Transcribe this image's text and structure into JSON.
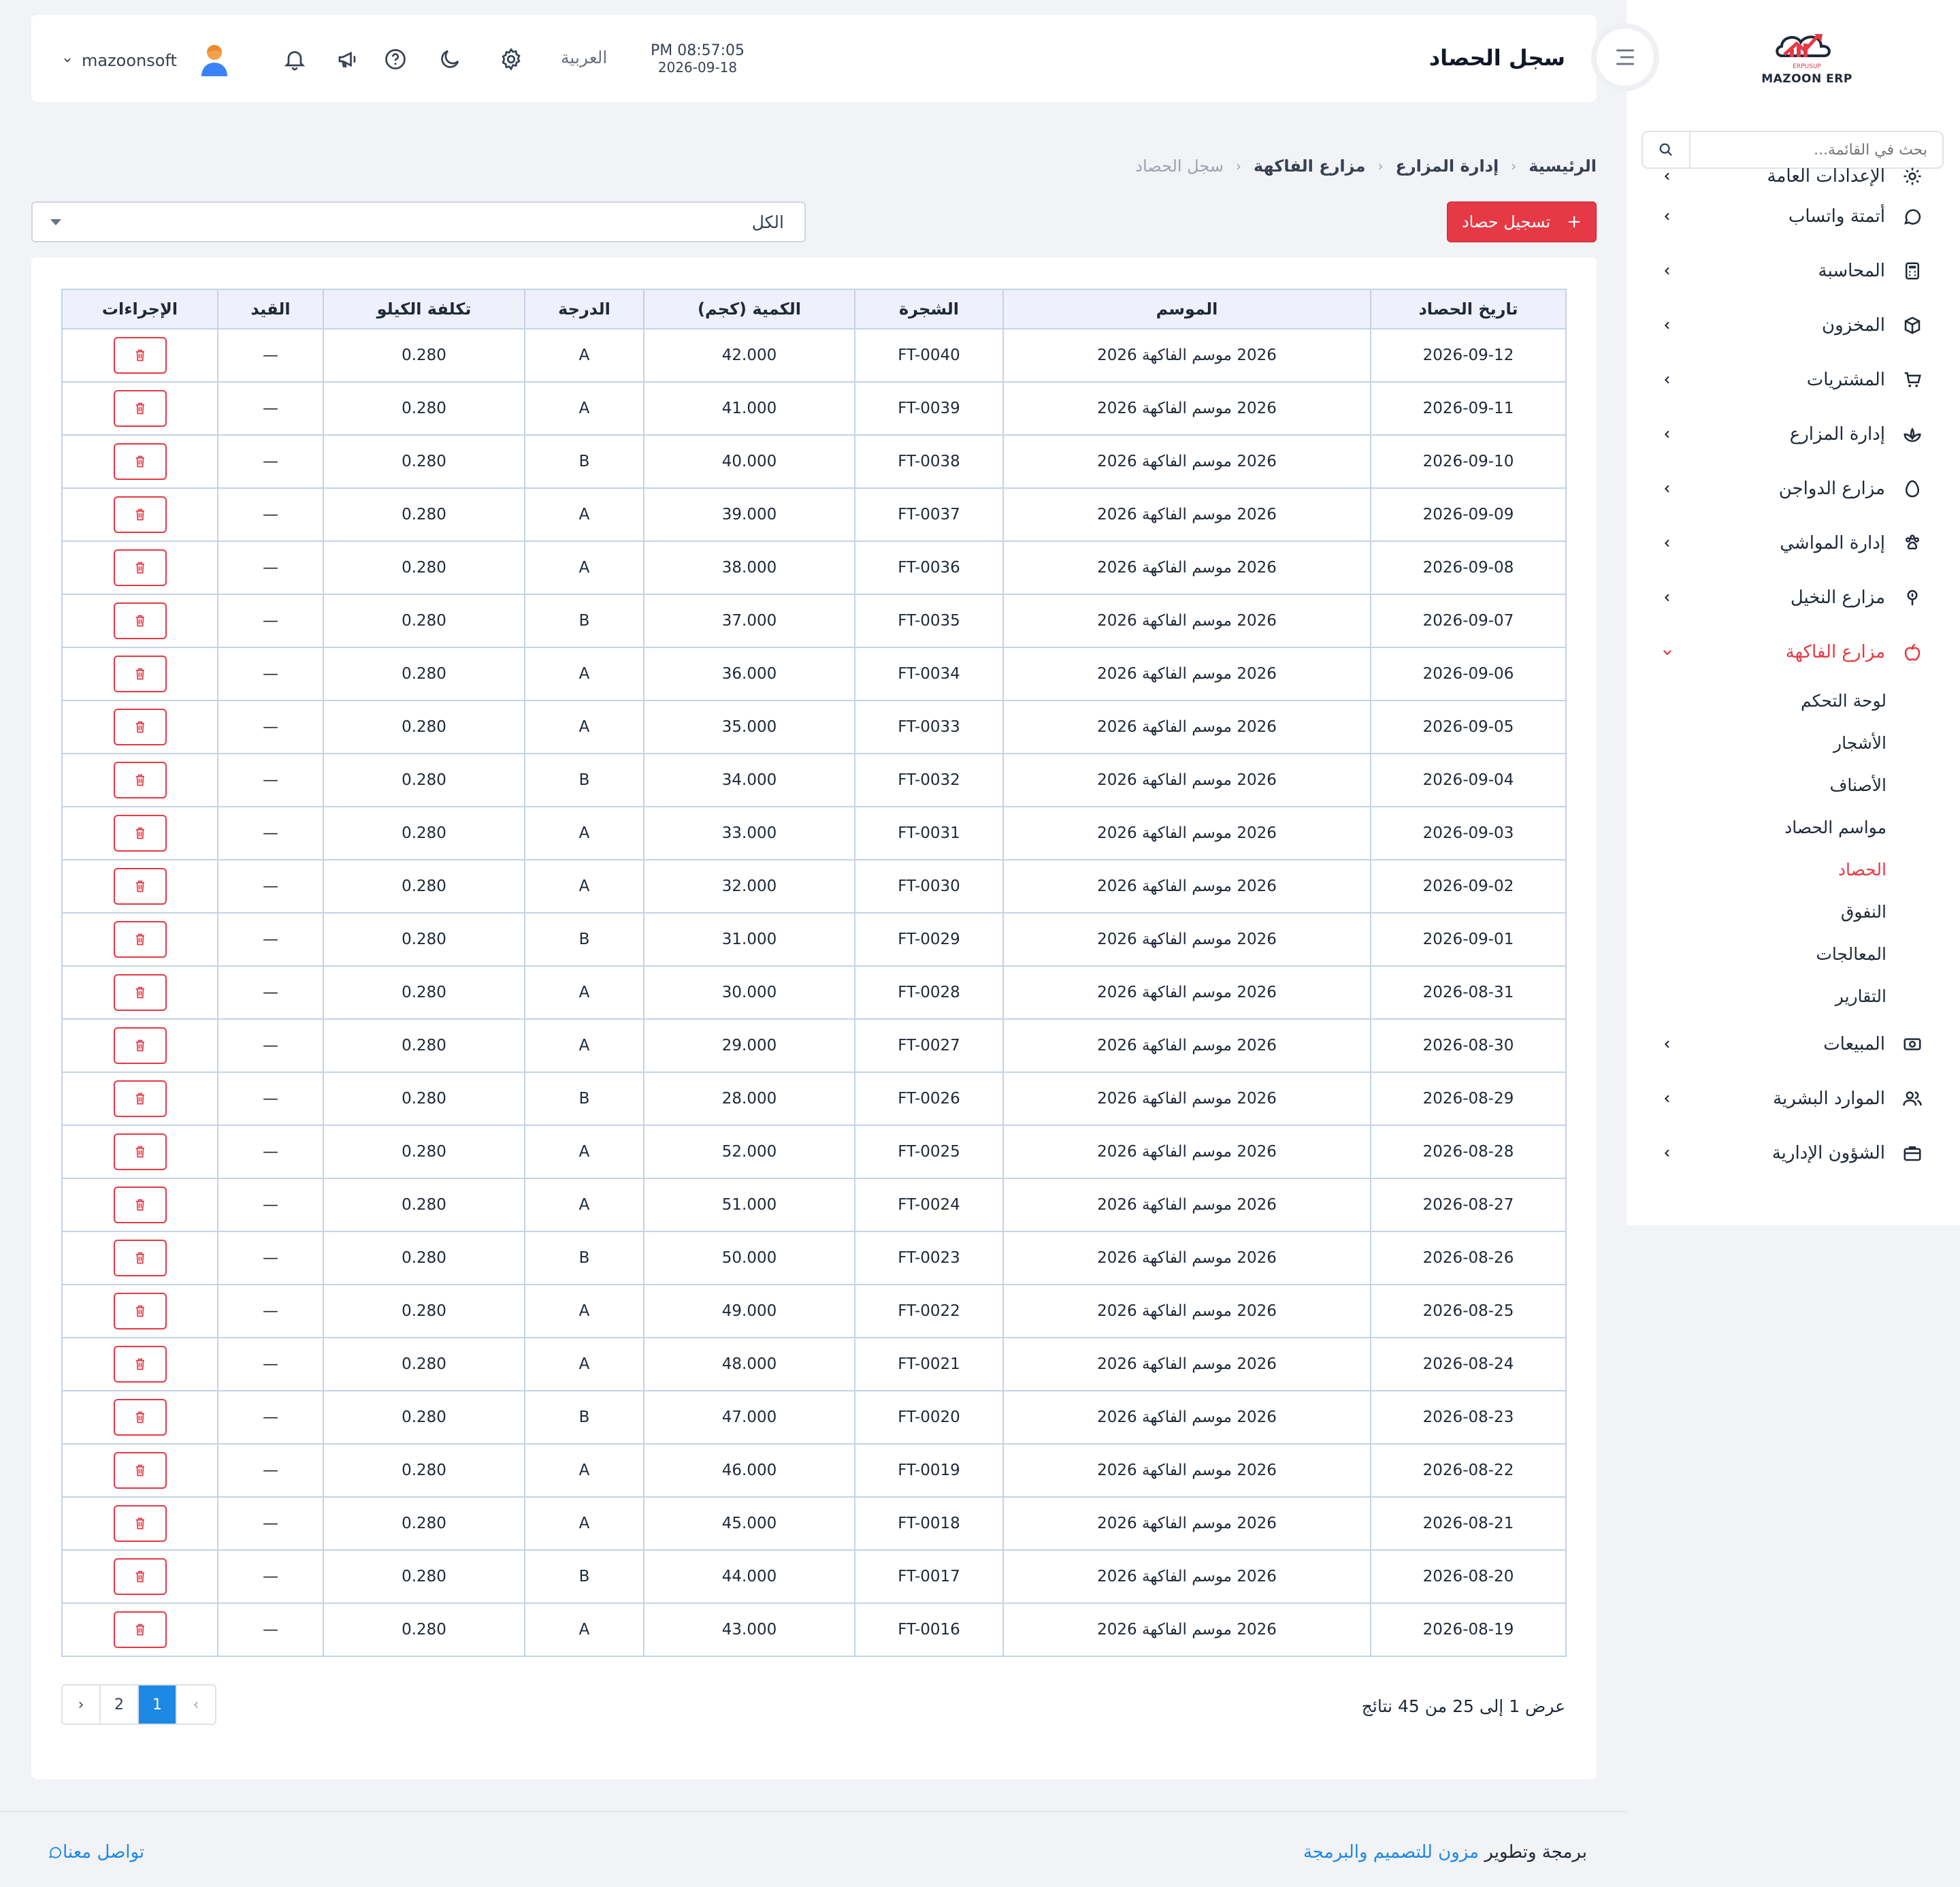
{
  "brand": {
    "logo_text": "MAZOON ERP",
    "logo_subtext": "ERPUSUP"
  },
  "sidebar": {
    "search_placeholder": "بحث في القائمة...",
    "items": [
      {
        "label": "الإعدادات العامة",
        "icon": "gear-icon"
      },
      {
        "label": "أتمتة واتساب",
        "icon": "whatsapp-icon"
      },
      {
        "label": "المحاسبة",
        "icon": "calculator-icon"
      },
      {
        "label": "المخزون",
        "icon": "box-icon"
      },
      {
        "label": "المشتريات",
        "icon": "cart-icon"
      },
      {
        "label": "إدارة المزارع",
        "icon": "plant-icon"
      },
      {
        "label": "مزارع الدواجن",
        "icon": "egg-icon"
      },
      {
        "label": "إدارة المواشي",
        "icon": "paw-icon"
      },
      {
        "label": "مزارع النخيل",
        "icon": "palm-icon"
      },
      {
        "label": "مزارع الفاكهة",
        "icon": "apple-icon"
      },
      {
        "label": "المبيعات",
        "icon": "cash-icon"
      },
      {
        "label": "الموارد البشرية",
        "icon": "users-icon"
      },
      {
        "label": "الشؤون الإدارية",
        "icon": "briefcase-icon"
      }
    ],
    "fruit_sub": [
      "لوحة التحكم",
      "الأشجار",
      "الأصناف",
      "مواسم الحصاد",
      "الحصاد",
      "النفوق",
      "المعالجات",
      "التقارير"
    ],
    "active_sub": "الحصاد"
  },
  "header": {
    "title": "سجل الحصاد",
    "time": "PM 08:57:05",
    "date": "2026-09-18",
    "language": "العربية",
    "username": "mazoonsoft"
  },
  "breadcrumb": [
    "الرئيسية",
    "إدارة المزارع",
    "مزارع الفاكهة",
    "سجل الحصاد"
  ],
  "actions": {
    "add_label": "تسجيل حصاد",
    "filter_value": "الكل"
  },
  "table": {
    "columns": [
      "تاريخ الحصاد",
      "الموسم",
      "الشجرة",
      "الكمية (كجم)",
      "الدرجة",
      "تكلفة الكيلو",
      "القيد",
      "الإجراءات"
    ],
    "rows": [
      [
        "2026-09-12",
        "2026 موسم الفاكهة 2026",
        "FT-0040",
        "42.000",
        "A",
        "0.280",
        "—"
      ],
      [
        "2026-09-11",
        "2026 موسم الفاكهة 2026",
        "FT-0039",
        "41.000",
        "A",
        "0.280",
        "—"
      ],
      [
        "2026-09-10",
        "2026 موسم الفاكهة 2026",
        "FT-0038",
        "40.000",
        "B",
        "0.280",
        "—"
      ],
      [
        "2026-09-09",
        "2026 موسم الفاكهة 2026",
        "FT-0037",
        "39.000",
        "A",
        "0.280",
        "—"
      ],
      [
        "2026-09-08",
        "2026 موسم الفاكهة 2026",
        "FT-0036",
        "38.000",
        "A",
        "0.280",
        "—"
      ],
      [
        "2026-09-07",
        "2026 موسم الفاكهة 2026",
        "FT-0035",
        "37.000",
        "B",
        "0.280",
        "—"
      ],
      [
        "2026-09-06",
        "2026 موسم الفاكهة 2026",
        "FT-0034",
        "36.000",
        "A",
        "0.280",
        "—"
      ],
      [
        "2026-09-05",
        "2026 موسم الفاكهة 2026",
        "FT-0033",
        "35.000",
        "A",
        "0.280",
        "—"
      ],
      [
        "2026-09-04",
        "2026 موسم الفاكهة 2026",
        "FT-0032",
        "34.000",
        "B",
        "0.280",
        "—"
      ],
      [
        "2026-09-03",
        "2026 موسم الفاكهة 2026",
        "FT-0031",
        "33.000",
        "A",
        "0.280",
        "—"
      ],
      [
        "2026-09-02",
        "2026 موسم الفاكهة 2026",
        "FT-0030",
        "32.000",
        "A",
        "0.280",
        "—"
      ],
      [
        "2026-09-01",
        "2026 موسم الفاكهة 2026",
        "FT-0029",
        "31.000",
        "B",
        "0.280",
        "—"
      ],
      [
        "2026-08-31",
        "2026 موسم الفاكهة 2026",
        "FT-0028",
        "30.000",
        "A",
        "0.280",
        "—"
      ],
      [
        "2026-08-30",
        "2026 موسم الفاكهة 2026",
        "FT-0027",
        "29.000",
        "A",
        "0.280",
        "—"
      ],
      [
        "2026-08-29",
        "2026 موسم الفاكهة 2026",
        "FT-0026",
        "28.000",
        "B",
        "0.280",
        "—"
      ],
      [
        "2026-08-28",
        "2026 موسم الفاكهة 2026",
        "FT-0025",
        "52.000",
        "A",
        "0.280",
        "—"
      ],
      [
        "2026-08-27",
        "2026 موسم الفاكهة 2026",
        "FT-0024",
        "51.000",
        "A",
        "0.280",
        "—"
      ],
      [
        "2026-08-26",
        "2026 موسم الفاكهة 2026",
        "FT-0023",
        "50.000",
        "B",
        "0.280",
        "—"
      ],
      [
        "2026-08-25",
        "2026 موسم الفاكهة 2026",
        "FT-0022",
        "49.000",
        "A",
        "0.280",
        "—"
      ],
      [
        "2026-08-24",
        "2026 موسم الفاكهة 2026",
        "FT-0021",
        "48.000",
        "A",
        "0.280",
        "—"
      ],
      [
        "2026-08-23",
        "2026 موسم الفاكهة 2026",
        "FT-0020",
        "47.000",
        "B",
        "0.280",
        "—"
      ],
      [
        "2026-08-22",
        "2026 موسم الفاكهة 2026",
        "FT-0019",
        "46.000",
        "A",
        "0.280",
        "—"
      ],
      [
        "2026-08-21",
        "2026 موسم الفاكهة 2026",
        "FT-0018",
        "45.000",
        "A",
        "0.280",
        "—"
      ],
      [
        "2026-08-20",
        "2026 موسم الفاكهة 2026",
        "FT-0017",
        "44.000",
        "B",
        "0.280",
        "—"
      ],
      [
        "2026-08-19",
        "2026 موسم الفاكهة 2026",
        "FT-0016",
        "43.000",
        "A",
        "0.280",
        "—"
      ]
    ]
  },
  "pagination": {
    "summary": "عرض 1 إلى 25 من 45 نتائج",
    "prev": "‹",
    "next": "›",
    "pages": [
      "1",
      "2"
    ],
    "current": "1"
  },
  "footer": {
    "credit_prefix": "برمجة وتطوير",
    "credit_link": "مزون للتصميم والبرمجة",
    "contact": "تواصل معنا"
  },
  "colors": {
    "accent": "#e53945",
    "primary": "#1e88e5",
    "table_border": "#c4d3e6",
    "header_bg": "#eef0fb"
  }
}
